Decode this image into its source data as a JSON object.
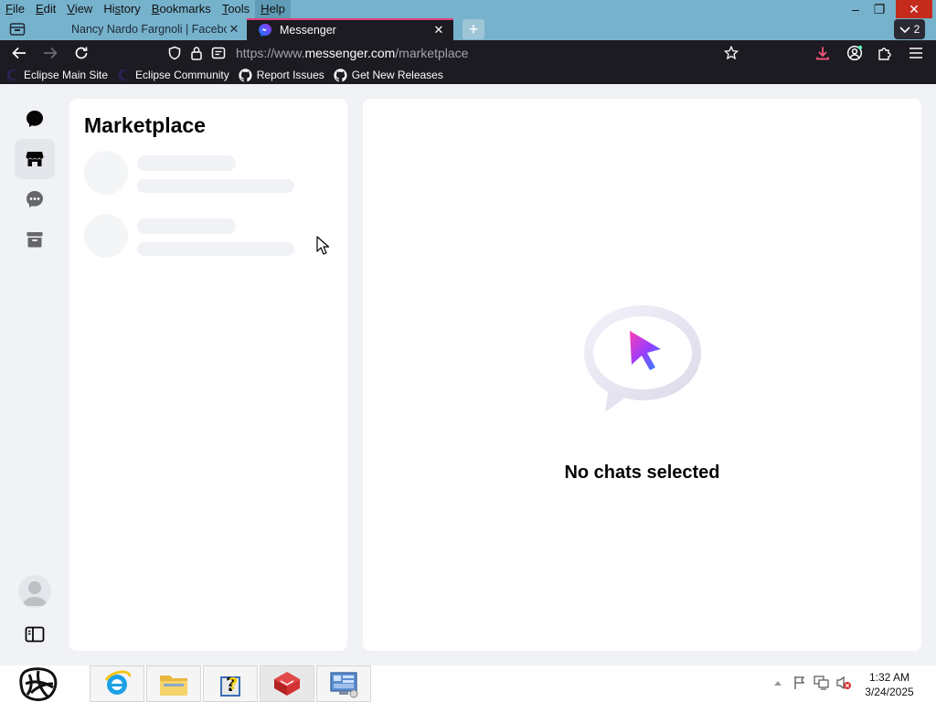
{
  "menu": {
    "items": [
      {
        "label": "File",
        "ul": "F",
        "rest": "ile"
      },
      {
        "label": "Edit",
        "ul": "E",
        "rest": "dit"
      },
      {
        "label": "View",
        "ul": "V",
        "rest": "iew"
      },
      {
        "label": "History",
        "pre": "Hi",
        "ul": "s",
        "rest": "tory"
      },
      {
        "label": "Bookmarks",
        "ul": "B",
        "rest": "ookmarks"
      },
      {
        "label": "Tools",
        "ul": "T",
        "rest": "ools"
      },
      {
        "label": "Help",
        "ul": "H",
        "rest": "elp"
      }
    ]
  },
  "window": {
    "minimize": "–",
    "restore": "❐",
    "close": "✕"
  },
  "tabs": [
    {
      "title": "Nancy Nardo Fargnoli | Faceboo",
      "close": "✕"
    },
    {
      "title": "Messenger",
      "close": "✕"
    }
  ],
  "tab_list_count": "2",
  "new_tab": "+",
  "url": {
    "prefix": "https://www.",
    "domain": "messenger.com",
    "path": "/marketplace"
  },
  "bookmarks": [
    {
      "label": "Eclipse Main Site",
      "icon": "eclipse-icon"
    },
    {
      "label": "Eclipse Community",
      "icon": "eclipse-icon"
    },
    {
      "label": "Report Issues",
      "icon": "github-icon"
    },
    {
      "label": "Get New Releases",
      "icon": "github-icon"
    }
  ],
  "messenger": {
    "list_title": "Marketplace",
    "empty_text": "No chats selected"
  },
  "clock": {
    "time": "1:32 AM",
    "date": "3/24/2025"
  },
  "colors": {
    "accent": "#e0407f",
    "chrome": "#1c1b22",
    "titlebar": "#76b2cc"
  }
}
